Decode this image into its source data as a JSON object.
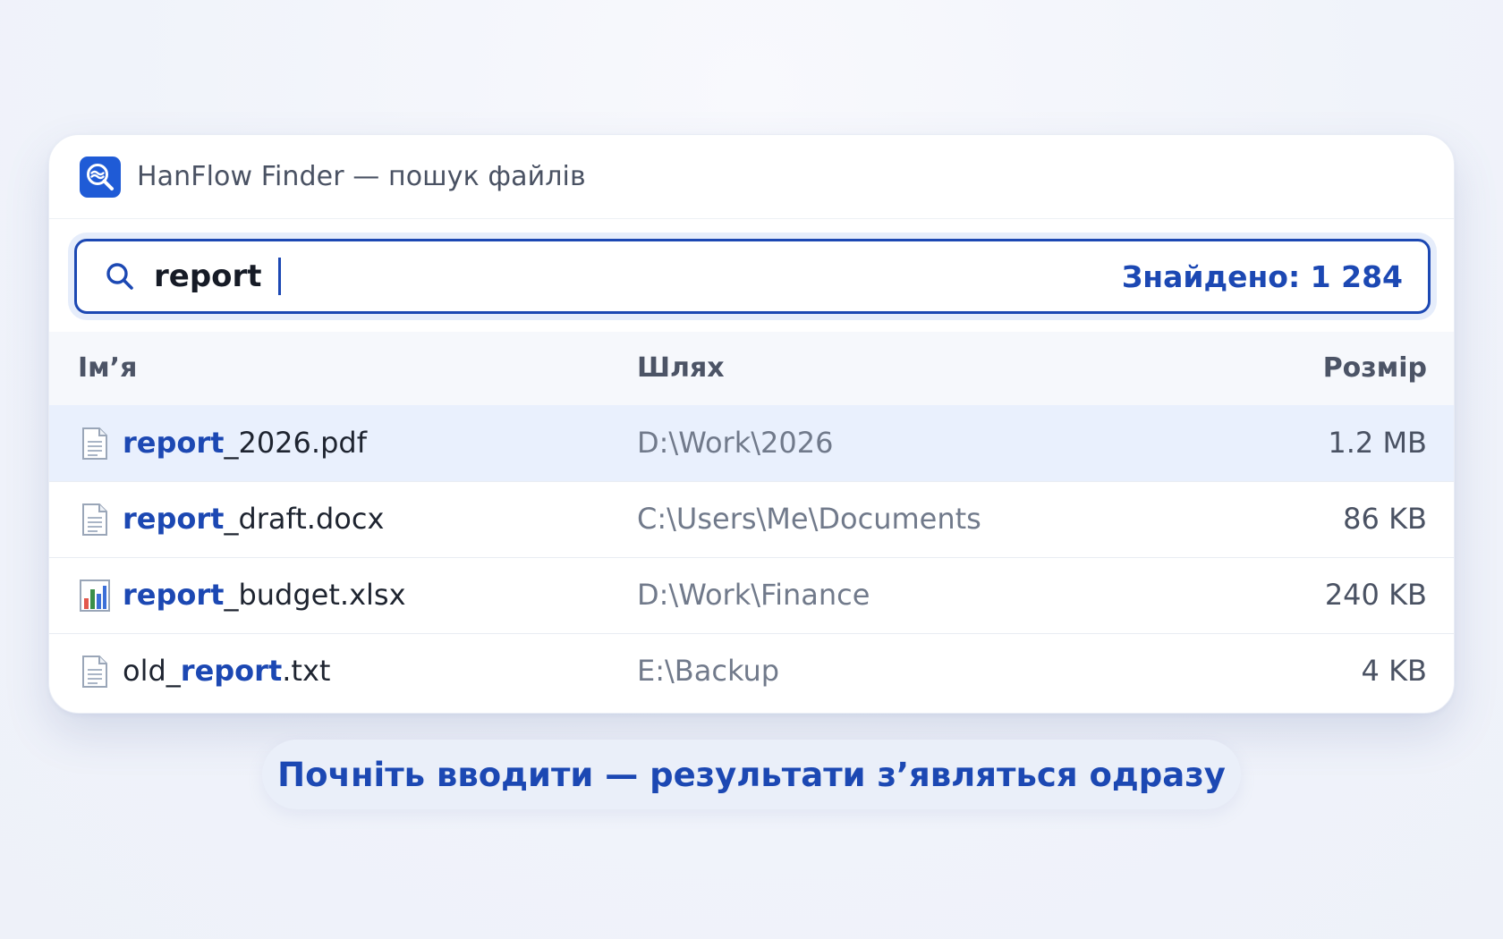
{
  "window": {
    "title": "HanFlow Finder — пошук файлів",
    "app_icon": "magnifier-wave-icon"
  },
  "search": {
    "value": "report",
    "found_label": "Знайдено: 1 284"
  },
  "table": {
    "headers": {
      "name": "Ім’я",
      "path": "Шлях",
      "size": "Розмір"
    },
    "rows": [
      {
        "icon": "document-icon",
        "name_prefix": "",
        "name_match": "report",
        "name_suffix": "_2026.pdf",
        "path": "D:\\Work\\2026",
        "size": "1.2 MB",
        "selected": true
      },
      {
        "icon": "document-icon",
        "name_prefix": "",
        "name_match": "report",
        "name_suffix": "_draft.docx",
        "path": "C:\\Users\\Me\\Documents",
        "size": "86 KB",
        "selected": false
      },
      {
        "icon": "bar-chart-icon",
        "name_prefix": "",
        "name_match": "report",
        "name_suffix": "_budget.xlsx",
        "path": "D:\\Work\\Finance",
        "size": "240 KB",
        "selected": false
      },
      {
        "icon": "document-icon",
        "name_prefix": "old_",
        "name_match": "report",
        "name_suffix": ".txt",
        "path": "E:\\Backup",
        "size": "4 KB",
        "selected": false
      }
    ]
  },
  "hint": {
    "text": "Почніть вводити — результати з’являться одразу"
  },
  "colors": {
    "accent": "#1c48b3",
    "selected_row": "#e9f0fd",
    "app_icon_bg": "#1f5bd6"
  }
}
